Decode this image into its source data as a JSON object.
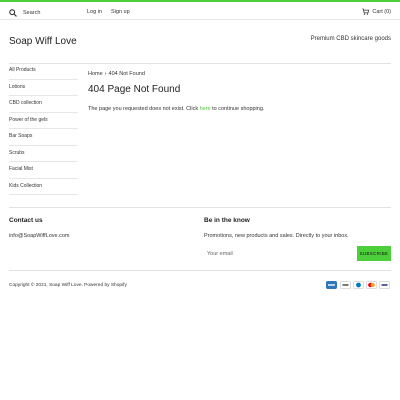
{
  "topbar": {
    "search_placeholder": "Search",
    "login_label": "Log in",
    "signup_label": "Sign up",
    "cart_label": "Cart (0)"
  },
  "header": {
    "brand": "Soap Wiff Love",
    "tagline": "Premium CBD skincare goods"
  },
  "sidebar": {
    "items": [
      {
        "label": "All Products"
      },
      {
        "label": "Lotions"
      },
      {
        "label": "CBD collection"
      },
      {
        "label": "Power of the gels"
      },
      {
        "label": "Bar Soaps"
      },
      {
        "label": "Scrubs"
      },
      {
        "label": "Facial Mist"
      },
      {
        "label": "Kids Collection"
      }
    ]
  },
  "main": {
    "breadcrumb_home": "Home",
    "breadcrumb_sep": "›",
    "breadcrumb_current": "404 Not Found",
    "title": "404 Page Not Found",
    "message_pre": "The page you requested does not exist. Click ",
    "message_link": "here",
    "message_post": " to continue shopping."
  },
  "footer": {
    "contact_heading": "Contact us",
    "contact_email": "info@SoapWiffLove.com",
    "newsletter_heading": "Be in the know",
    "newsletter_text": "Promotions, new products and sales. Directly to your inbox.",
    "email_placeholder": "Your email",
    "subscribe_label": "SUBSCRIBE",
    "copyright": "Copyright © 2021, Soap Wiff Love. Powered by Shopify"
  },
  "payment_icons": [
    "american-express-icon",
    "apple-pay-icon",
    "diners-club-icon",
    "mastercard-icon",
    "visa-icon"
  ],
  "colors": {
    "accent": "#4ccf3a",
    "text": "#222222",
    "divider": "#e2e2e2"
  }
}
